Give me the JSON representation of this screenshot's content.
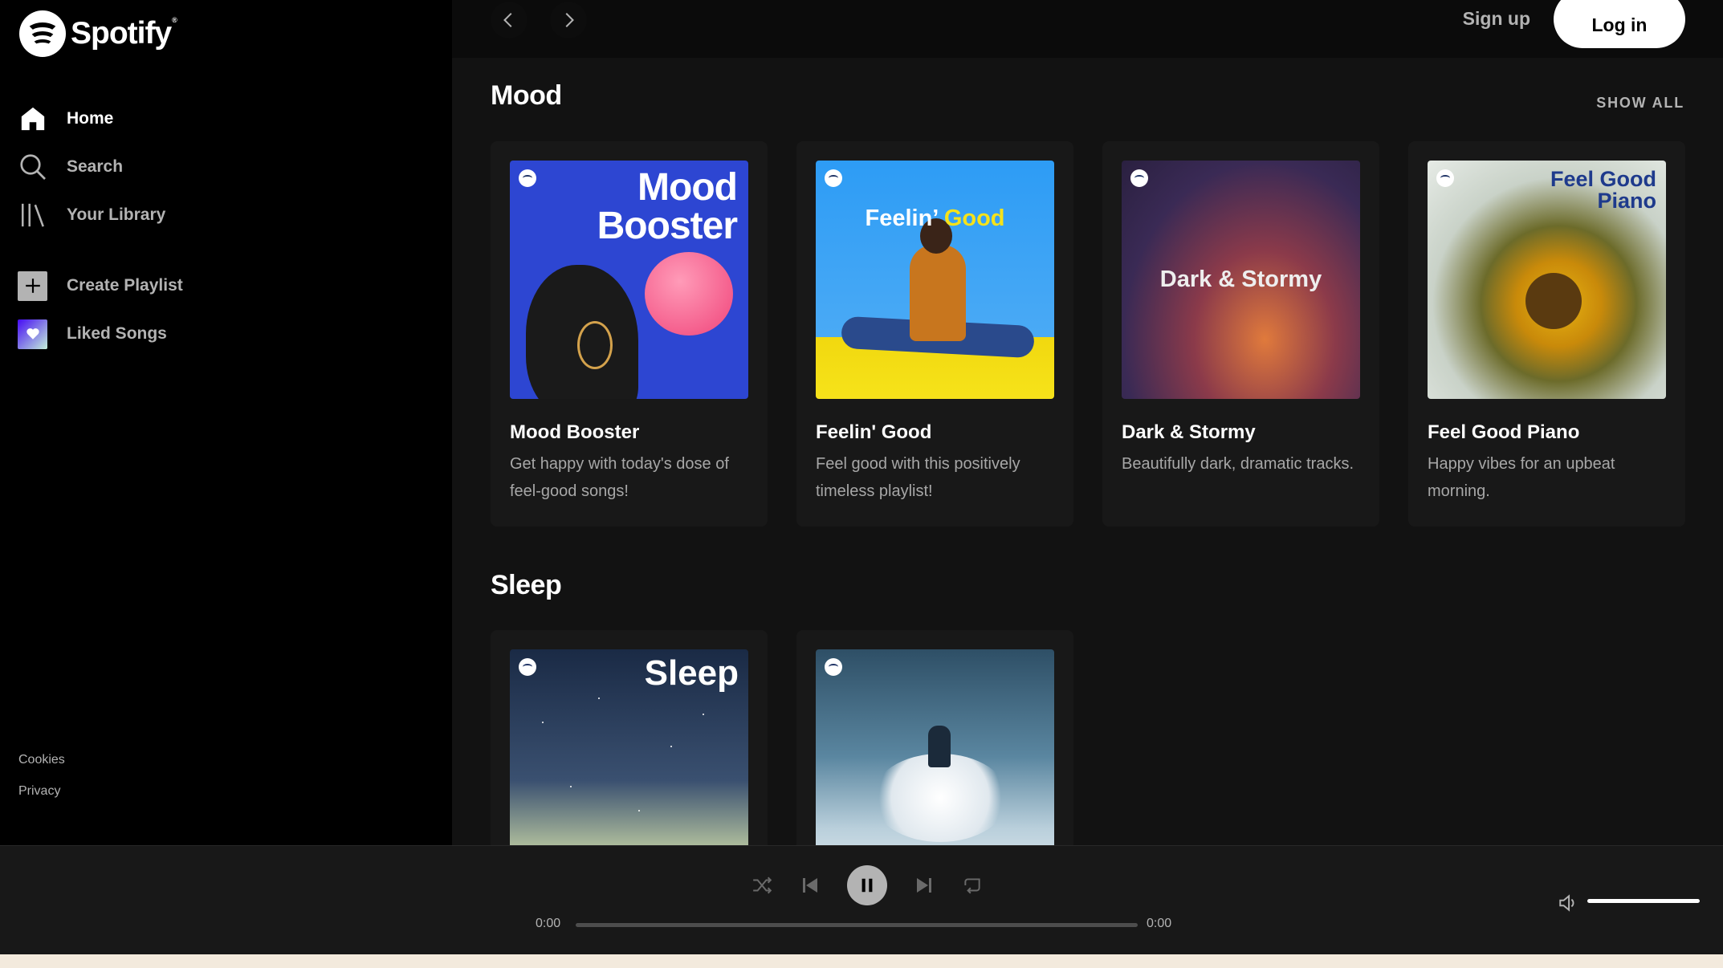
{
  "brand": {
    "name": "Spotify",
    "reg": "®"
  },
  "sidebar": {
    "nav": [
      {
        "label": "Home",
        "icon": "home-icon",
        "active": true
      },
      {
        "label": "Search",
        "icon": "search-icon",
        "active": false
      },
      {
        "label": "Your Library",
        "icon": "library-icon",
        "active": false
      }
    ],
    "actions": [
      {
        "label": "Create Playlist",
        "icon": "plus-icon"
      },
      {
        "label": "Liked Songs",
        "icon": "heart-icon"
      }
    ],
    "legal": [
      "Cookies",
      "Privacy"
    ]
  },
  "topbar": {
    "signup": "Sign up",
    "login": "Log in"
  },
  "sections": [
    {
      "title": "Mood",
      "show_all": "SHOW ALL",
      "cards": [
        {
          "title": "Mood Booster",
          "desc": "Get happy with today's dose of feel-good songs!",
          "cover_text": "Mood Booster"
        },
        {
          "title": "Feelin' Good",
          "desc": "Feel good with this positively timeless playlist!",
          "cover_text_1": "Feelin’",
          "cover_text_2": "Good"
        },
        {
          "title": "Dark & Stormy",
          "desc": "Beautifully dark, dramatic tracks.",
          "cover_text": "Dark & Stormy"
        },
        {
          "title": "Feel Good Piano",
          "desc": "Happy vibes for an upbeat morning.",
          "cover_text_1": "Feel Good",
          "cover_text_2": "Piano"
        }
      ]
    },
    {
      "title": "Sleep",
      "cards": [
        {
          "cover_text": "Sleep"
        },
        {
          "cover_text": ""
        }
      ]
    }
  ],
  "player": {
    "current_time": "0:00",
    "duration": "0:00",
    "progress": 0,
    "volume": 1.0
  },
  "colors": {
    "accent": "#1db954",
    "background": "#121212",
    "sidebar": "#000000",
    "card": "#181818"
  }
}
